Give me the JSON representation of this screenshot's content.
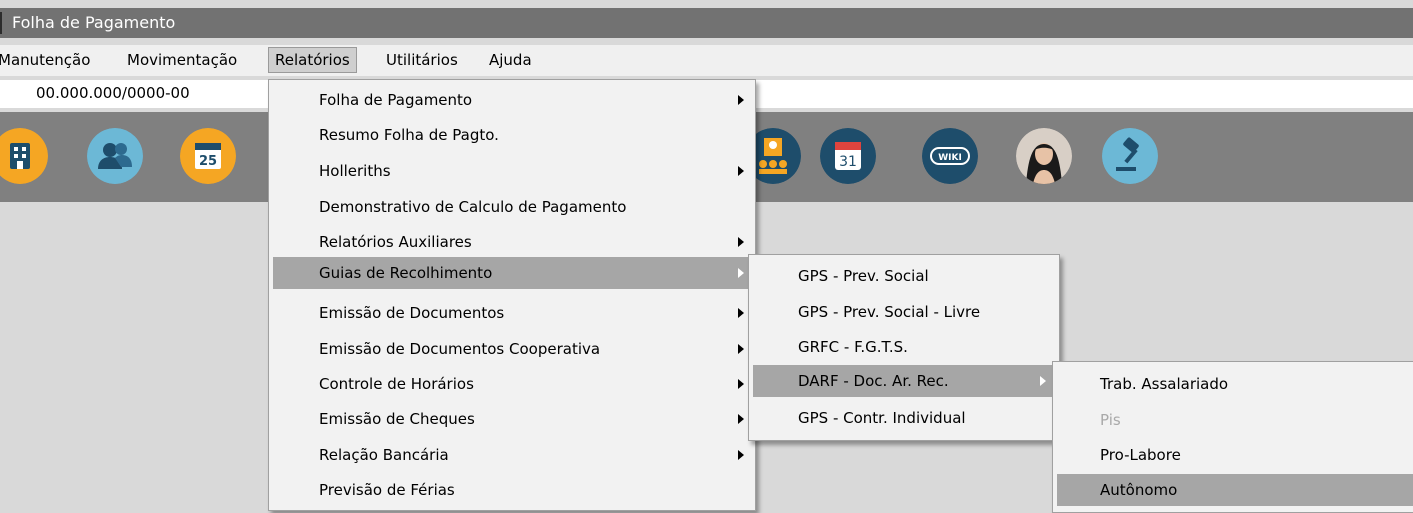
{
  "window": {
    "title": "Folha de Pagamento"
  },
  "menubar": {
    "items": [
      {
        "label": "Manutenção"
      },
      {
        "label": "Movimentação"
      },
      {
        "label": "Relatórios"
      },
      {
        "label": "Utilitários"
      },
      {
        "label": "Ajuda"
      }
    ]
  },
  "company": {
    "cnpj": "00.000.000/0000-00"
  },
  "toolbar": {
    "icons": [
      "building-icon",
      "users-icon",
      "calendar-25-icon",
      "meeting-icon",
      "calendar-31-icon",
      "wiki-icon",
      "assistant-avatar",
      "gavel-icon"
    ],
    "calendar_day_1": "25",
    "calendar_day_2": "31",
    "wiki_label": "WIKI"
  },
  "relatorios_menu": {
    "items": [
      {
        "label": "Folha de Pagamento",
        "submenu": true
      },
      {
        "label": "Resumo Folha de Pagto.",
        "submenu": false
      },
      {
        "label": "Holleriths",
        "submenu": true
      },
      {
        "label": "Demonstrativo de Calculo de Pagamento",
        "submenu": false
      },
      {
        "label": "Relatórios Auxiliares",
        "submenu": true
      },
      {
        "label": "Guias de Recolhimento",
        "submenu": true,
        "highlighted": true
      },
      {
        "label": "Emissão de Documentos",
        "submenu": true
      },
      {
        "label": "Emissão de Documentos Cooperativa",
        "submenu": true
      },
      {
        "label": "Controle de Horários",
        "submenu": true
      },
      {
        "label": "Emissão de Cheques",
        "submenu": true
      },
      {
        "label": "Relação Bancária",
        "submenu": true
      },
      {
        "label": "Previsão de Férias",
        "submenu": false
      }
    ]
  },
  "guias_submenu": {
    "items": [
      {
        "label": "GPS - Prev. Social",
        "submenu": false
      },
      {
        "label": "GPS - Prev. Social - Livre",
        "submenu": false
      },
      {
        "label": "GRFC - F.G.T.S.",
        "submenu": false
      },
      {
        "label": "DARF - Doc. Ar. Rec.",
        "submenu": true,
        "highlighted": true
      },
      {
        "label": "GPS - Contr. Individual",
        "submenu": false
      }
    ]
  },
  "darf_submenu": {
    "items": [
      {
        "label": "Trab. Assalariado",
        "enabled": true
      },
      {
        "label": "Pis",
        "enabled": false
      },
      {
        "label": "Pro-Labore",
        "enabled": true
      },
      {
        "label": "Autônomo",
        "enabled": true,
        "highlighted": true
      }
    ]
  },
  "colors": {
    "titlebar": "#727272",
    "toolbar": "#808080",
    "menu_bg": "#f2f2f2",
    "highlight": "#a6a6a6",
    "icon_orange": "#f5a623",
    "icon_blue": "#6cb8d6",
    "icon_navy": "#1e4d6b"
  }
}
